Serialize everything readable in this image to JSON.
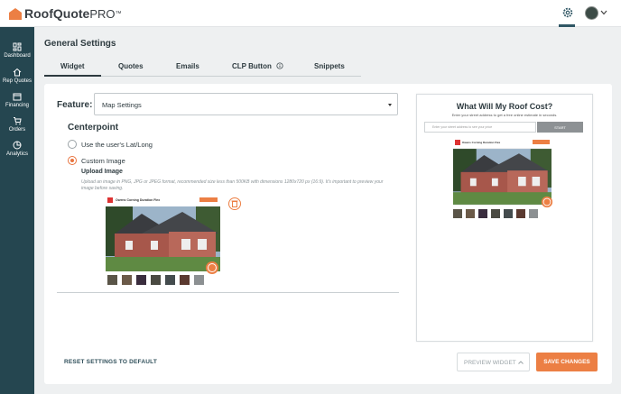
{
  "app": {
    "name_main": "RoofQuote",
    "name_suffix": "PRO",
    "trademark": "™"
  },
  "sidebar": {
    "items": [
      {
        "label": "Dashboard",
        "icon": "dashboard-icon"
      },
      {
        "label": "Rep Quotes",
        "icon": "rep-quotes-icon"
      },
      {
        "label": "Financing",
        "icon": "financing-icon"
      },
      {
        "label": "Orders",
        "icon": "orders-icon"
      },
      {
        "label": "Analytics",
        "icon": "analytics-icon"
      }
    ]
  },
  "page": {
    "title": "General Settings"
  },
  "tabs": [
    {
      "label": "Widget",
      "active": true
    },
    {
      "label": "Quotes"
    },
    {
      "label": "Emails"
    },
    {
      "label": "CLP Button"
    },
    {
      "label": "Snippets"
    }
  ],
  "feature": {
    "label": "Feature:",
    "selected": "Map Settings"
  },
  "centerpoint": {
    "title": "Centerpoint",
    "option_latlong": "Use the user's Lat/Long",
    "option_custom": "Custom Image",
    "selected": "Custom Image"
  },
  "upload": {
    "label": "Upload Image",
    "hint": "Upload an image in PNG, JPG or JPEG format, recommended size less than 500KB with dimensions 1280x720 px (16:9). It's important to preview your image before saving.",
    "image_caption": "Owens Corning Duration Flex"
  },
  "footer": {
    "reset": "RESET SETTINGS TO DEFAULT",
    "preview": "PREVIEW WIDGET",
    "save": "SAVE CHANGES"
  },
  "preview": {
    "title": "What Will My Roof Cost?",
    "subtitle": "Enter your street address to get a free online estimate in seconds.",
    "input_placeholder": "Enter your street address to see your price",
    "start": "START"
  },
  "colors": {
    "accent": "#ec7f44",
    "sidebar": "#254650",
    "text": "#2d3a3f"
  }
}
